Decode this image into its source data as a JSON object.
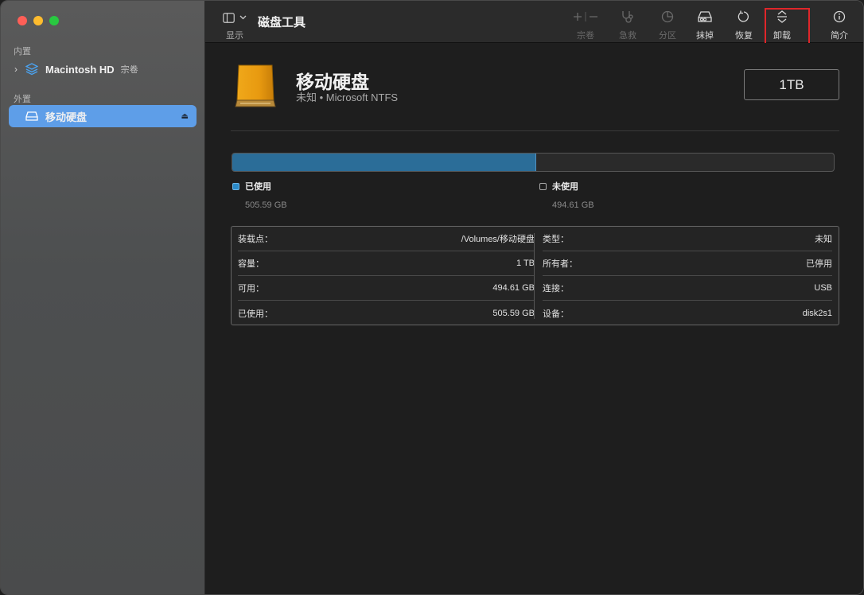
{
  "sidebar": {
    "internal_label": "内置",
    "external_label": "外置",
    "internal_items": [
      {
        "name": "Macintosh HD",
        "sub": "宗卷"
      }
    ],
    "external_items": [
      {
        "name": "移动硬盘",
        "selected": true
      }
    ]
  },
  "toolbar": {
    "view_label": "显示",
    "app_title": "磁盘工具",
    "buttons": [
      {
        "label": "宗卷",
        "icon": "plus-minus-icon",
        "enabled": false
      },
      {
        "label": "急救",
        "icon": "stethoscope-icon",
        "enabled": false
      },
      {
        "label": "分区",
        "icon": "pie-partition-icon",
        "enabled": false
      },
      {
        "label": "抹掉",
        "icon": "erase-drive-icon",
        "enabled": true
      },
      {
        "label": "恢复",
        "icon": "restore-icon",
        "enabled": true
      },
      {
        "label": "卸载",
        "icon": "unmount-icon",
        "enabled": true,
        "highlighted": true
      },
      {
        "label": "简介",
        "icon": "info-icon",
        "enabled": true
      }
    ]
  },
  "disk": {
    "name": "移动硬盘",
    "subtitle": "未知 • Microsoft NTFS",
    "capacity_badge": "1TB",
    "icon": "external-drive-icon"
  },
  "usage": {
    "used_fraction": 0.5056,
    "used": {
      "label": "已使用",
      "value": "505.59 GB",
      "color": "#2b8ac8"
    },
    "free": {
      "label": "未使用",
      "value": "494.61 GB"
    }
  },
  "info": {
    "left": [
      {
        "key": "装载点：",
        "value": "/Volumes/移动硬盘"
      },
      {
        "key": "容量：",
        "value": "1 TB"
      },
      {
        "key": "可用：",
        "value": "494.61 GB"
      },
      {
        "key": "已使用：",
        "value": "505.59 GB"
      }
    ],
    "right": [
      {
        "key": "类型：",
        "value": "未知"
      },
      {
        "key": "所有者：",
        "value": "已停用"
      },
      {
        "key": "连接：",
        "value": "USB"
      },
      {
        "key": "设备：",
        "value": "disk2s1"
      }
    ]
  },
  "colors": {
    "selection": "#5e9ee8",
    "usage_fill": "#2b6d98",
    "highlight_box": "#e0262a"
  }
}
